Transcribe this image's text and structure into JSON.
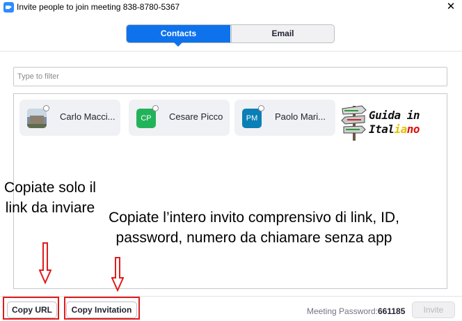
{
  "window": {
    "title": "Invite people to join meeting 838-8780-5367",
    "close_glyph": "✕"
  },
  "tabs": [
    {
      "label": "Contacts",
      "active": true
    },
    {
      "label": "Email",
      "active": false
    }
  ],
  "filter": {
    "placeholder": "Type to filter",
    "value": ""
  },
  "contacts": [
    {
      "name": "Carlo Macci...",
      "avatar_type": "photo",
      "initials": ""
    },
    {
      "name": "Cesare Picco",
      "avatar_type": "initials",
      "initials": "CP",
      "color": "#22b35a"
    },
    {
      "name": "Paolo Mari...",
      "avatar_type": "initials",
      "initials": "PM",
      "color": "#0a7fb5"
    }
  ],
  "logo": {
    "line1": "Guida in",
    "line2_a": "Ital",
    "line2_b": "ia",
    "line2_c": "no"
  },
  "annotations": {
    "left": "Copiate solo il link da inviare",
    "right": "Copiate l’intero invito comprensivo di link, ID, password, numero da chiamare senza app",
    "highlight_color": "#e01b1b"
  },
  "footer": {
    "copy_url_label": "Copy URL",
    "copy_invitation_label": "Copy Invitation",
    "password_label": "Meeting Password:",
    "password_value": "661185",
    "invite_label": "Invite"
  },
  "colors": {
    "accent": "#0e72ed",
    "card_bg": "#f0f1f5"
  }
}
